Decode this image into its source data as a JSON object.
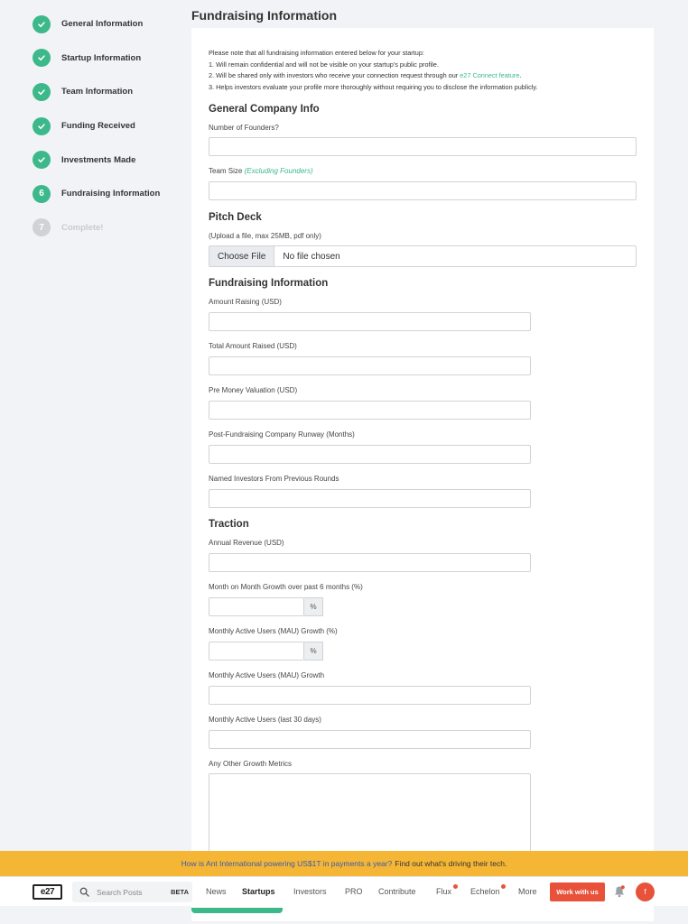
{
  "steps": [
    {
      "number": "1",
      "label": "General Information",
      "done": true
    },
    {
      "number": "2",
      "label": "Startup Information",
      "done": true
    },
    {
      "number": "3",
      "label": "Team Information",
      "done": true
    },
    {
      "number": "4",
      "label": "Funding Received",
      "done": true
    },
    {
      "number": "5",
      "label": "Investments Made",
      "done": true
    },
    {
      "number": "6",
      "label": "Fundraising Information",
      "done": false
    },
    {
      "number": "7",
      "label": "Complete!",
      "done": false
    }
  ],
  "page_title": "Fundraising Information",
  "notice": {
    "intro": "Please note that all fundraising information entered below for your startup:",
    "line1": "1. Will remain confidential and will not be visible on your startup's public profile.",
    "line2_prefix": "2. Will be shared only with investors who receive your connection request through our ",
    "line2_link": "e27 Connect feature",
    "line2_suffix": ".",
    "line3": "3. Helps investors evaluate your profile more thoroughly without requiring you to disclose the information publicly."
  },
  "sections": {
    "general": "General Company Info",
    "pitch": "Pitch Deck",
    "fundraising": "Fundraising Information",
    "traction": "Traction"
  },
  "fields": {
    "founders": "Number of Founders?",
    "team_size": "Team Size",
    "team_size_hint": "(Excluding Founders)",
    "pitch_hint": "(Upload a file, max 25MB, pdf only)",
    "choose_file": "Choose File",
    "no_file": "No file chosen",
    "amount_raising": "Amount Raising (USD)",
    "total_raised": "Total Amount Raised (USD)",
    "pre_money": "Pre Money Valuation (USD)",
    "runway": "Post-Fundraising Company Runway (Months)",
    "named_investors": "Named Investors From Previous Rounds",
    "annual_revenue": "Annual Revenue (USD)",
    "mom_growth": "Month on Month Growth over past 6 months (%)",
    "mau_growth_pct": "Monthly Active Users (MAU) Growth (%)",
    "mau_growth": "Monthly Active Users (MAU) Growth",
    "mau_30": "Monthly Active Users (last 30 days)",
    "other_metrics": "Any Other Growth Metrics",
    "percent": "%"
  },
  "promo": {
    "question": "How is Ant International powering US$1T in payments a year?",
    "answer": "Find out what's driving their tech."
  },
  "nav": {
    "logo": "e27",
    "search_placeholder": "Search Posts",
    "beta": "BETA",
    "items": [
      "News",
      "Startups",
      "Investors",
      "PRO",
      "Contribute",
      "Flux",
      "Echelon",
      "More"
    ],
    "work": "Work with us",
    "avatar": "f"
  },
  "colors": {
    "accent": "#3cb88a",
    "brand_orange": "#e8523a",
    "banner": "#f4b634"
  }
}
